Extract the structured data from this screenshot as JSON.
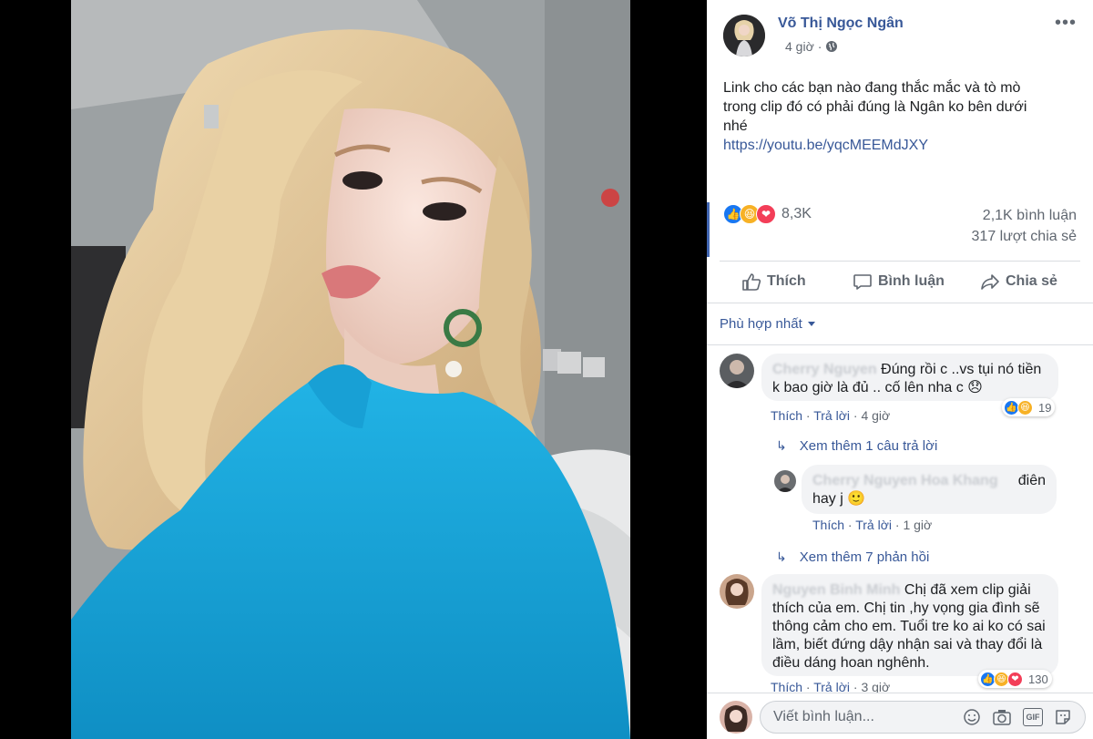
{
  "post": {
    "author": "Võ Thị Ngọc Ngân",
    "time": "4 giờ",
    "privacy_icon": "globe-icon",
    "text_lines": [
      "Link cho các bạn nào đang thắc mắc và tò mò",
      "trong clip đó có phải đúng là Ngân ko bên dưới",
      "nhé"
    ],
    "link": "https://youtu.be/yqcMEEMdJXY"
  },
  "stats": {
    "reactions_count": "8,3K",
    "reaction_icons": [
      "like-icon",
      "haha-icon",
      "love-icon"
    ],
    "comments": "2,1K bình luận",
    "shares": "317 lượt chia sẻ"
  },
  "actions": {
    "like": "Thích",
    "comment": "Bình luận",
    "share": "Chia sẻ"
  },
  "sort": {
    "label": "Phù hợp nhất"
  },
  "comments": [
    {
      "name": "Cherry Nguyen",
      "text_line1": "Đúng rồi c ..vs tụi nó tiền",
      "text_line2": "k bao giờ là đủ .. cố lên nha c 😞",
      "reactions": "19",
      "like": "Thích",
      "reply": "Trả lời",
      "time": "4 giờ",
      "more_replies": "Xem thêm 1 câu trả lời",
      "reply_item": {
        "name": "Cherry Nguyen Hoa Khang",
        "text_line1": "điên",
        "text_line2": "hay j 🙂",
        "like": "Thích",
        "reply": "Trả lời",
        "time": "1 giờ"
      },
      "more_replies_2": "Xem thêm 7 phản hồi"
    },
    {
      "name": "Nguyen Binh Minh",
      "text_lines": [
        "Chị đã xem clip giải",
        "thích của em. Chị tin ,hy vọng gia đình sẽ",
        "thông cảm cho em. Tuổi tre ko ai ko có sai",
        "lầm, biết đứng dậy nhận sai và thay đổi là",
        "điều dáng hoan nghênh."
      ],
      "reactions": "130",
      "like": "Thích",
      "reply": "Trả lời",
      "time": "3 giờ"
    }
  ],
  "composer": {
    "placeholder": "Viết bình luận...",
    "icons": [
      "emoji-icon",
      "camera-icon",
      "gif-icon",
      "sticker-icon"
    ],
    "gif_label": "GIF"
  },
  "colors": {
    "link_blue": "#385898",
    "like_blue": "#1877f2",
    "love_red": "#f33e58",
    "haha_yellow": "#f7b125",
    "dress": "#1aa5d6",
    "hair": "#e3c99a"
  }
}
